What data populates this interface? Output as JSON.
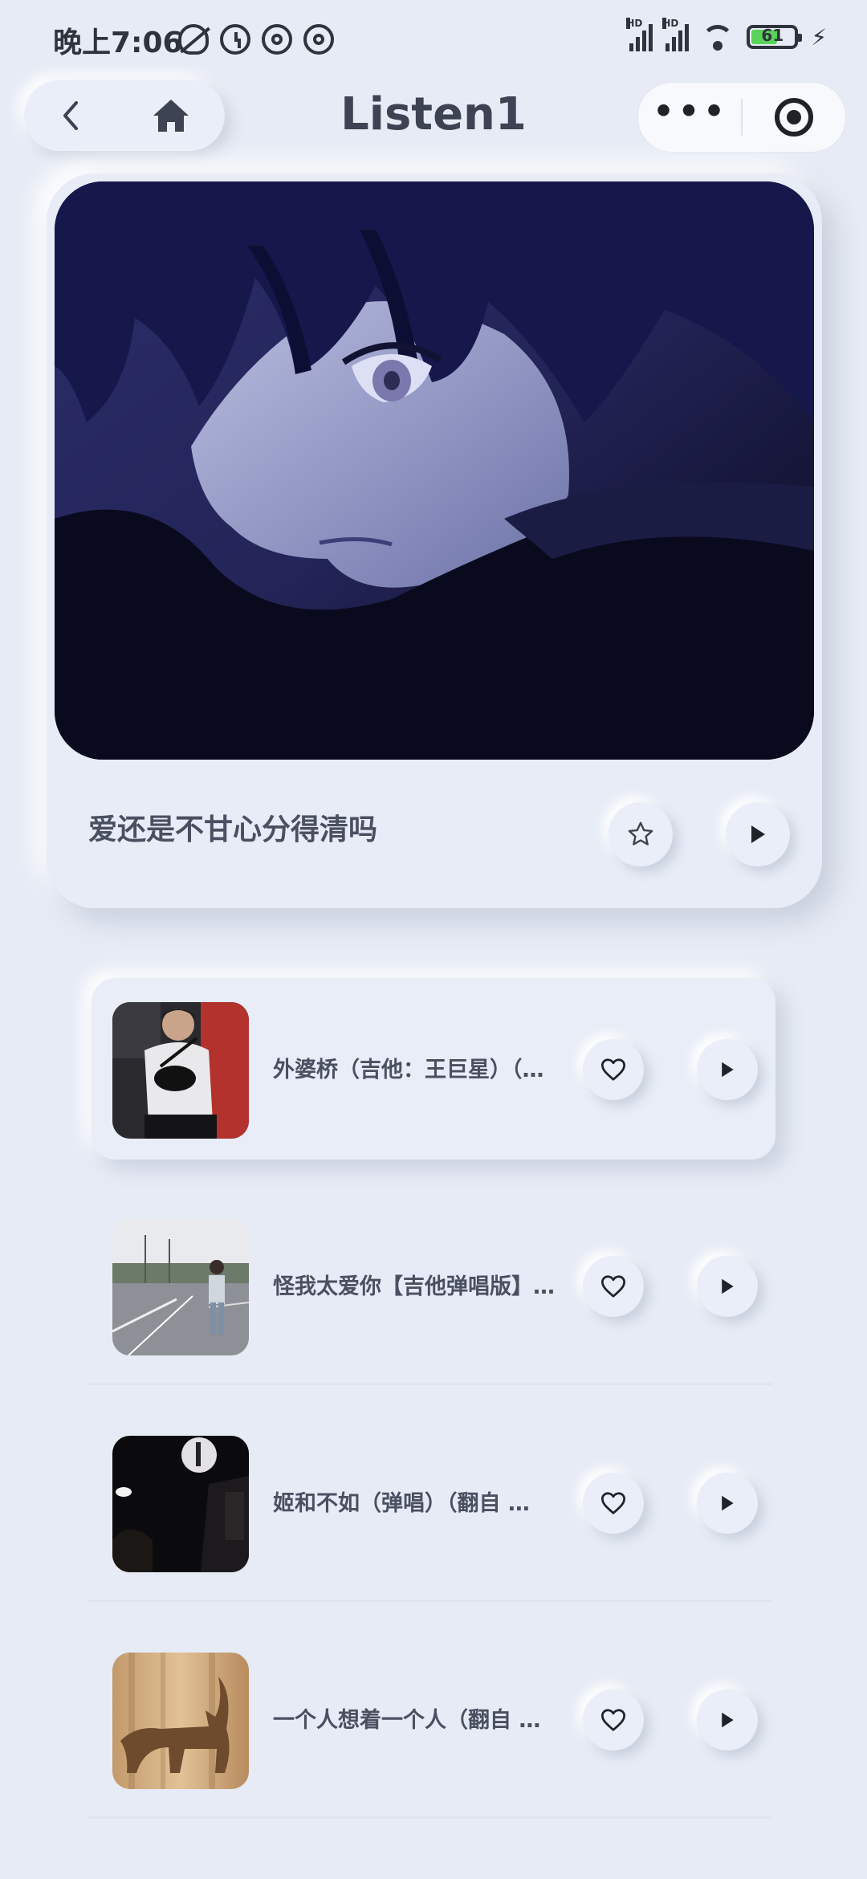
{
  "status_bar": {
    "time": "晚上7:06",
    "battery_level": "61",
    "signal_1_label": "HD",
    "signal_2_label": "HD",
    "icons": [
      "mute-bell-icon",
      "alarm-icon",
      "at-icon",
      "at-icon",
      "signal-icon",
      "signal-icon",
      "wifi-icon",
      "battery-icon",
      "charging-icon"
    ]
  },
  "nav": {
    "title": "Listen1",
    "back_icon": "chevron-left-icon",
    "home_icon": "home-icon",
    "more_icon": "more-dots-icon",
    "close_icon": "target-icon"
  },
  "featured": {
    "title": "爱还是不甘心分得清吗",
    "star_icon": "star-icon",
    "play_icon": "play-icon"
  },
  "songs": [
    {
      "title": "外婆桥（吉他：王巨星）（…"
    },
    {
      "title": "怪我太爱你【吉他弹唱版】…"
    },
    {
      "title": "姬和不如（弹唱）（翻自 …"
    },
    {
      "title": "一个人想着一个人（翻自 …"
    }
  ],
  "colors": {
    "background": "#e6ebf5",
    "text": "#3d4352",
    "battery_fill": "#5ad35a"
  }
}
